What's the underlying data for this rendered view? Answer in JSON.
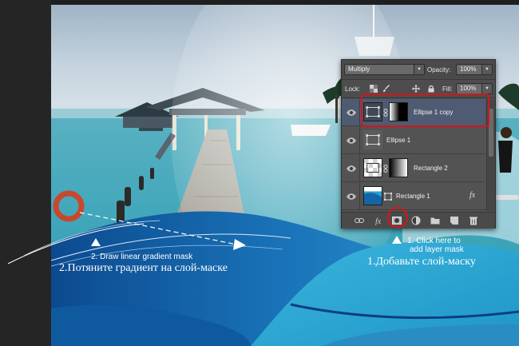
{
  "layers_panel": {
    "blend_mode": "Multiply",
    "opacity_label": "Opacity:",
    "opacity_value": "100%",
    "lock_label": "Lock:",
    "fill_label": "Fill:",
    "fill_value": "100%",
    "fx_badge": "fx",
    "layers": [
      {
        "name": "Ellipse 1 copy",
        "selected": true
      },
      {
        "name": "Ellipse 1",
        "selected": false
      },
      {
        "name": "Rectangle 2",
        "selected": false
      },
      {
        "name": "Rectangle 1",
        "selected": false
      }
    ],
    "footer_icons": [
      "link-icon",
      "fx-icon",
      "add-mask-icon",
      "adjustment-icon",
      "group-folder-icon",
      "new-layer-icon",
      "trash-icon"
    ]
  },
  "annotations": {
    "step2_en": "2. Draw linear gradient mask",
    "step2_ru": "2.Потяните градиент на слой-маске",
    "step1_en_line1": "1. Click here to",
    "step1_en_line2": "add layer mask",
    "step1_ru": "1.Добавьте слой-маску"
  },
  "colors": {
    "highlight_red": "#d7141b",
    "selected_layer": "#4e5b72",
    "panel_gray": "#535353"
  }
}
